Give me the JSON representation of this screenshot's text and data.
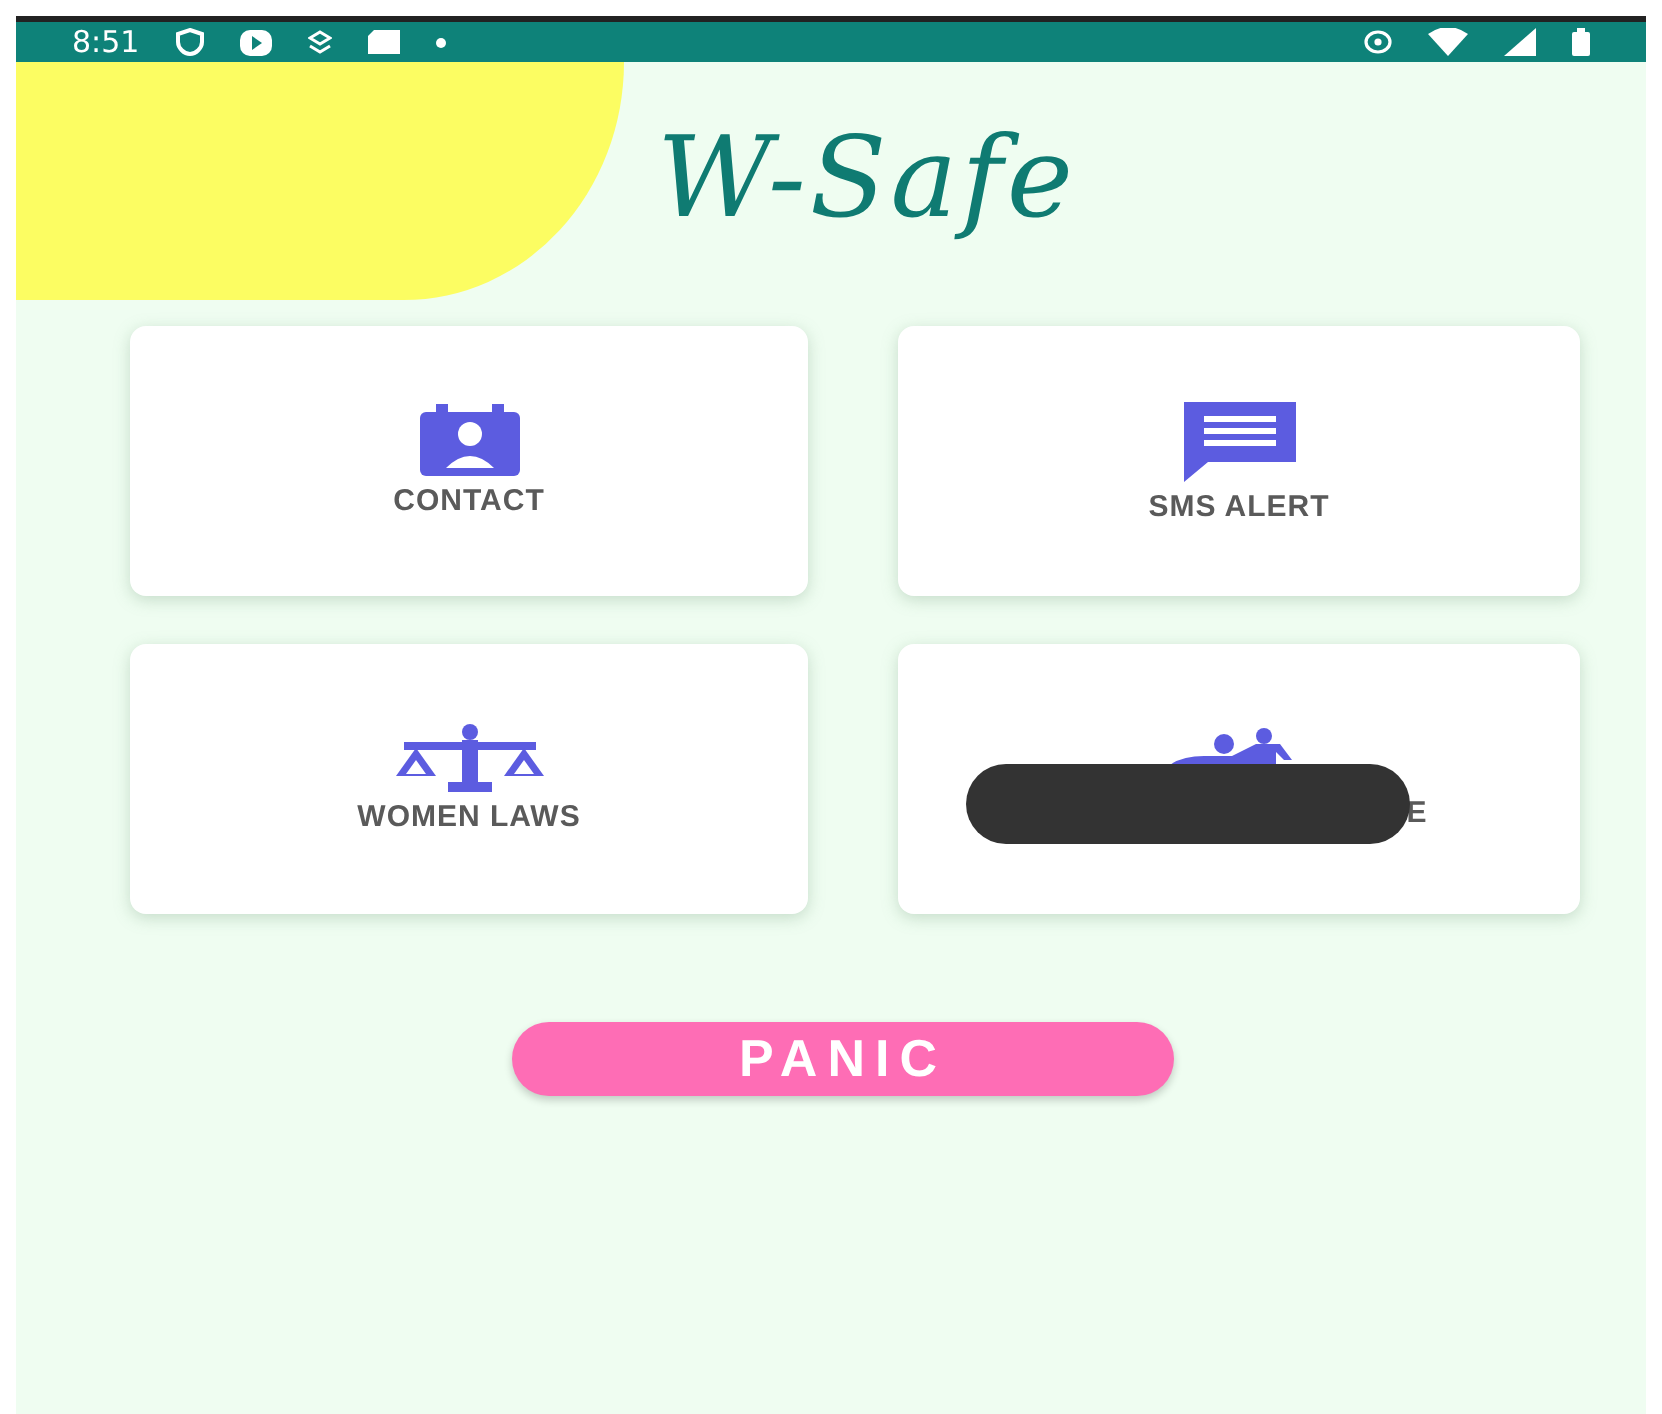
{
  "status_bar": {
    "time": "8:51"
  },
  "app_title": "W-Safe",
  "tiles": [
    {
      "label": "CONTACT",
      "kind": "contact",
      "redacted": false
    },
    {
      "label": "SMS ALERT",
      "kind": "sms",
      "redacted": false
    },
    {
      "label": "WOMEN LAWS",
      "kind": "laws",
      "redacted": false
    },
    {
      "label": "E",
      "kind": "helpers",
      "redacted": true
    }
  ],
  "panic_button": {
    "label": "PANIC"
  }
}
